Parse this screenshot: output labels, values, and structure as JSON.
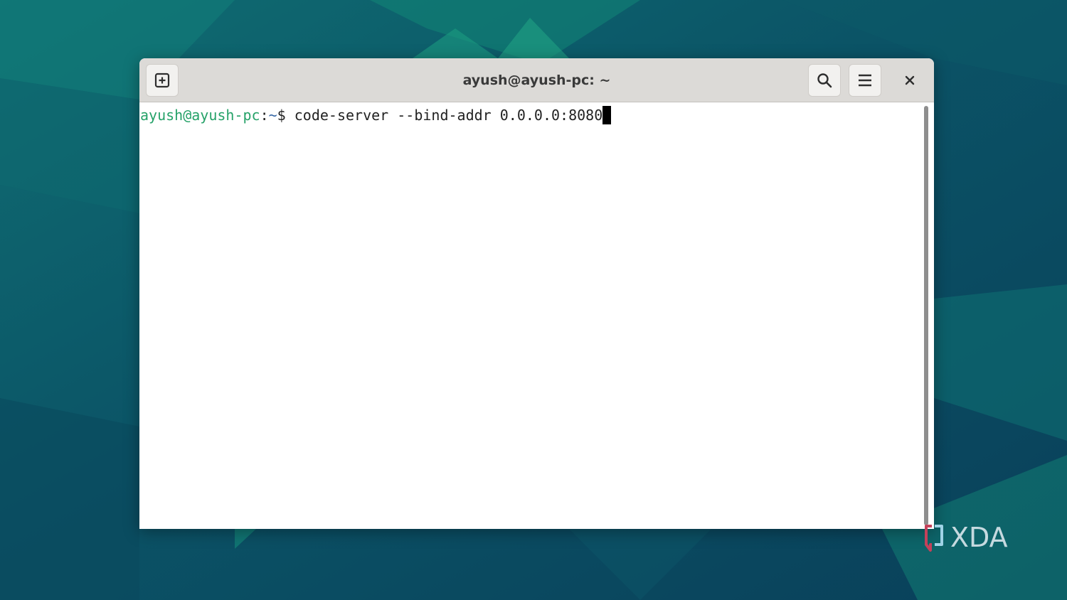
{
  "window": {
    "title": "ayush@ayush-pc: ~"
  },
  "titlebar": {
    "buttons": [
      {
        "name": "new-tab",
        "icon": "new-tab-icon"
      },
      {
        "name": "search",
        "icon": "search-icon"
      },
      {
        "name": "menu",
        "icon": "hamburger-menu-icon"
      },
      {
        "name": "close",
        "icon": "close-icon"
      }
    ]
  },
  "terminal": {
    "prompt_user": "ayush@ayush-pc",
    "prompt_colon": ":",
    "prompt_path": "~",
    "prompt_symbol": "$ ",
    "command": "code-server --bind-addr 0.0.0.0:8080"
  },
  "watermark": {
    "text": "XDA"
  },
  "colors": {
    "wallpaper_base": "#0b4a5e",
    "wallpaper_accent": "#148c7c",
    "titlebar_bg": "#dcdad7",
    "prompt_user": "#26a269",
    "prompt_path": "#3465a4"
  }
}
